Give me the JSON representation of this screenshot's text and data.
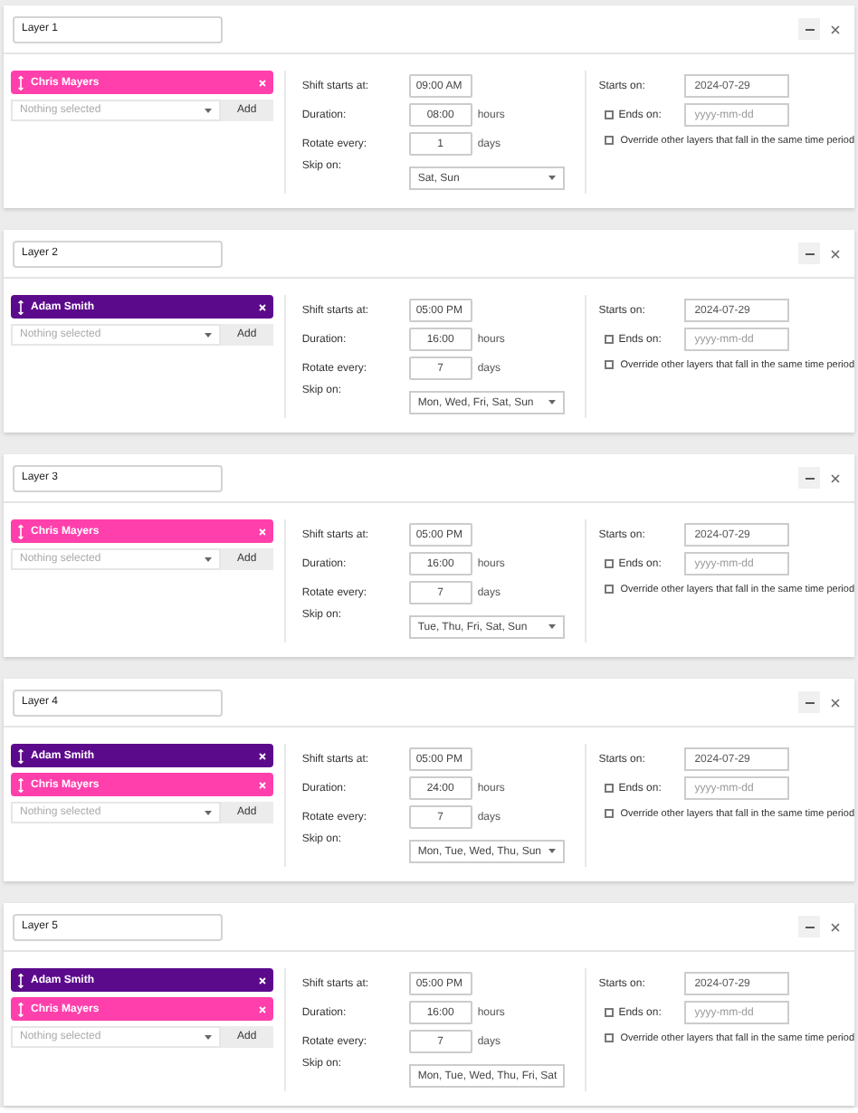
{
  "layers": [
    {
      "name": "Layer 1",
      "members": [
        {
          "name": "Chris Mayers",
          "color": "#ff3fac"
        }
      ],
      "member_select": {
        "placeholder": "Nothing selected"
      },
      "add_button": "Add",
      "shift_label": "Shift starts at:",
      "shift_start": "09:00 AM",
      "duration_label": "Duration:",
      "duration": "08:00",
      "duration_unit": "hours",
      "rotate_label": "Rotate every:",
      "rotate_every": "1",
      "rotate_unit": "days",
      "skip_label": "Skip on:",
      "skip_on": "Sat, Sun",
      "starts_label": "Starts on:",
      "starts_on": "2024-07-29",
      "ends_on": {
        "label": "Ends on:",
        "checked": false,
        "placeholder": "yyyy-mm-dd"
      },
      "override": {
        "label": "Override other layers that fall in the same time period",
        "checked": false
      }
    },
    {
      "name": "Layer 2",
      "members": [
        {
          "name": "Adam Smith",
          "color": "#5c0a8c"
        }
      ],
      "member_select": {
        "placeholder": "Nothing selected"
      },
      "add_button": "Add",
      "shift_label": "Shift starts at:",
      "shift_start": "05:00 PM",
      "duration_label": "Duration:",
      "duration": "16:00",
      "duration_unit": "hours",
      "rotate_label": "Rotate every:",
      "rotate_every": "7",
      "rotate_unit": "days",
      "skip_label": "Skip on:",
      "skip_on": "Mon, Wed, Fri, Sat, Sun",
      "starts_label": "Starts on:",
      "starts_on": "2024-07-29",
      "ends_on": {
        "label": "Ends on:",
        "checked": false,
        "placeholder": "yyyy-mm-dd"
      },
      "override": {
        "label": "Override other layers that fall in the same time period",
        "checked": false
      }
    },
    {
      "name": "Layer 3",
      "members": [
        {
          "name": "Chris Mayers",
          "color": "#ff3fac"
        }
      ],
      "member_select": {
        "placeholder": "Nothing selected"
      },
      "add_button": "Add",
      "shift_label": "Shift starts at:",
      "shift_start": "05:00 PM",
      "duration_label": "Duration:",
      "duration": "16:00",
      "duration_unit": "hours",
      "rotate_label": "Rotate every:",
      "rotate_every": "7",
      "rotate_unit": "days",
      "skip_label": "Skip on:",
      "skip_on": "Tue, Thu, Fri, Sat, Sun",
      "starts_label": "Starts on:",
      "starts_on": "2024-07-29",
      "ends_on": {
        "label": "Ends on:",
        "checked": false,
        "placeholder": "yyyy-mm-dd"
      },
      "override": {
        "label": "Override other layers that fall in the same time period",
        "checked": false
      }
    },
    {
      "name": "Layer 4",
      "members": [
        {
          "name": "Adam Smith",
          "color": "#5c0a8c"
        },
        {
          "name": "Chris Mayers",
          "color": "#ff3fac"
        }
      ],
      "member_select": {
        "placeholder": "Nothing selected"
      },
      "add_button": "Add",
      "shift_label": "Shift starts at:",
      "shift_start": "05:00 PM",
      "duration_label": "Duration:",
      "duration": "24:00",
      "duration_unit": "hours",
      "rotate_label": "Rotate every:",
      "rotate_every": "7",
      "rotate_unit": "days",
      "skip_label": "Skip on:",
      "skip_on": "Mon, Tue, Wed, Thu, Sun",
      "starts_label": "Starts on:",
      "starts_on": "2024-07-29",
      "ends_on": {
        "label": "Ends on:",
        "checked": false,
        "placeholder": "yyyy-mm-dd"
      },
      "override": {
        "label": "Override other layers that fall in the same time period",
        "checked": false
      }
    },
    {
      "name": "Layer 5",
      "members": [
        {
          "name": "Adam Smith",
          "color": "#5c0a8c"
        },
        {
          "name": "Chris Mayers",
          "color": "#ff3fac"
        }
      ],
      "member_select": {
        "placeholder": "Nothing selected"
      },
      "add_button": "Add",
      "shift_label": "Shift starts at:",
      "shift_start": "05:00 PM",
      "duration_label": "Duration:",
      "duration": "16:00",
      "duration_unit": "hours",
      "rotate_label": "Rotate every:",
      "rotate_every": "7",
      "rotate_unit": "days",
      "skip_label": "Skip on:",
      "skip_on": "Mon, Tue, Wed, Thu, Fri, Sat",
      "starts_label": "Starts on:",
      "starts_on": "2024-07-29",
      "ends_on": {
        "label": "Ends on:",
        "checked": false,
        "placeholder": "yyyy-mm-dd"
      },
      "override": {
        "label": "Override other layers that fall in the same time period",
        "checked": false
      }
    }
  ]
}
